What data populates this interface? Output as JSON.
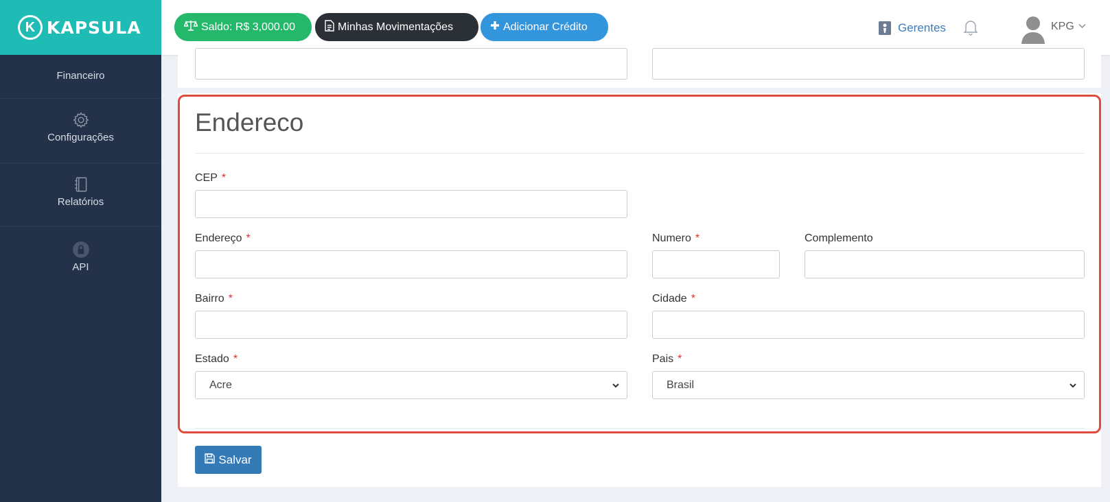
{
  "brand": {
    "logo_letter": "K",
    "name": "KAPSULA"
  },
  "sidebar": {
    "items": [
      {
        "label": "Financeiro",
        "icon": "money-icon"
      },
      {
        "label": "Configurações",
        "icon": "gear-icon"
      },
      {
        "label": "Relatórios",
        "icon": "notebook-icon"
      },
      {
        "label": "API",
        "icon": "lock-icon"
      }
    ]
  },
  "topbar": {
    "saldo": "Saldo: R$ 3,000.00",
    "movimentacoes": "Minhas Movimentações",
    "adicionar": "Adicionar Crédito",
    "gerentes": "Gerentes",
    "user": "KPG"
  },
  "form": {
    "section_title": "Endereco",
    "required_mark": "*",
    "fields": {
      "cep": {
        "label": "CEP",
        "value": ""
      },
      "endereco": {
        "label": "Endereço",
        "value": ""
      },
      "numero": {
        "label": "Numero",
        "value": ""
      },
      "complemento": {
        "label": "Complemento",
        "value": ""
      },
      "bairro": {
        "label": "Bairro",
        "value": ""
      },
      "cidade": {
        "label": "Cidade",
        "value": ""
      },
      "estado": {
        "label": "Estado",
        "selected": "Acre"
      },
      "pais": {
        "label": "Pais",
        "selected": "Brasil"
      }
    },
    "save_label": "Salvar"
  },
  "colors": {
    "sidebar_bg": "#243249",
    "brand_teal": "#1ebcb5",
    "saldo_green": "#26b86a",
    "mov_dark": "#2b2f36",
    "add_blue": "#3396dd",
    "highlight_red": "#de4b3c",
    "save_blue": "#337ab7"
  }
}
